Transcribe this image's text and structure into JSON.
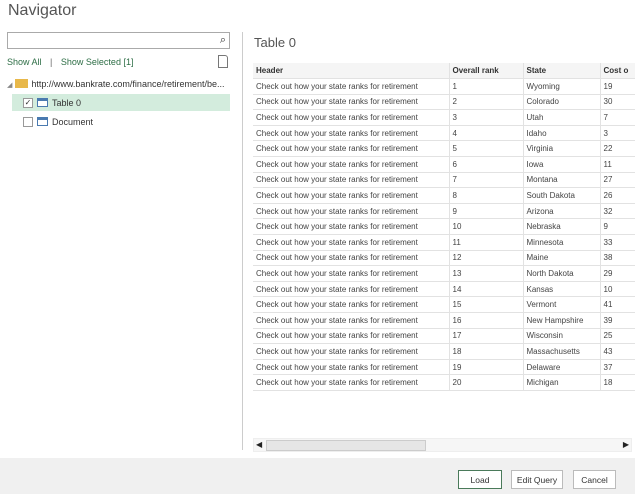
{
  "title": "Navigator",
  "search": {
    "placeholder": "",
    "icon": "search-icon"
  },
  "links": {
    "show_all": "Show All",
    "sep": "|",
    "show_selected": "Show Selected [1]"
  },
  "tree": {
    "root": "http://www.bankrate.com/finance/retirement/be...",
    "items": [
      {
        "label": "Table 0",
        "checked": true
      },
      {
        "label": "Document",
        "checked": false
      }
    ]
  },
  "preview": {
    "title": "Table 0",
    "columns": [
      "Header",
      "Overall rank",
      "State",
      "Cost o"
    ],
    "rows": [
      [
        "Check out how your state ranks for retirement",
        "1",
        "Wyoming",
        "19"
      ],
      [
        "Check out how your state ranks for retirement",
        "2",
        "Colorado",
        "30"
      ],
      [
        "Check out how your state ranks for retirement",
        "3",
        "Utah",
        "7"
      ],
      [
        "Check out how your state ranks for retirement",
        "4",
        "Idaho",
        "3"
      ],
      [
        "Check out how your state ranks for retirement",
        "5",
        "Virginia",
        "22"
      ],
      [
        "Check out how your state ranks for retirement",
        "6",
        "Iowa",
        "11"
      ],
      [
        "Check out how your state ranks for retirement",
        "7",
        "Montana",
        "27"
      ],
      [
        "Check out how your state ranks for retirement",
        "8",
        "South Dakota",
        "26"
      ],
      [
        "Check out how your state ranks for retirement",
        "9",
        "Arizona",
        "32"
      ],
      [
        "Check out how your state ranks for retirement",
        "10",
        "Nebraska",
        "9"
      ],
      [
        "Check out how your state ranks for retirement",
        "11",
        "Minnesota",
        "33"
      ],
      [
        "Check out how your state ranks for retirement",
        "12",
        "Maine",
        "38"
      ],
      [
        "Check out how your state ranks for retirement",
        "13",
        "North Dakota",
        "29"
      ],
      [
        "Check out how your state ranks for retirement",
        "14",
        "Kansas",
        "10"
      ],
      [
        "Check out how your state ranks for retirement",
        "15",
        "Vermont",
        "41"
      ],
      [
        "Check out how your state ranks for retirement",
        "16",
        "New Hampshire",
        "39"
      ],
      [
        "Check out how your state ranks for retirement",
        "17",
        "Wisconsin",
        "25"
      ],
      [
        "Check out how your state ranks for retirement",
        "18",
        "Massachusetts",
        "43"
      ],
      [
        "Check out how your state ranks for retirement",
        "19",
        "Delaware",
        "37"
      ],
      [
        "Check out how your state ranks for retirement",
        "20",
        "Michigan",
        "18"
      ]
    ]
  },
  "buttons": {
    "load": "Load",
    "edit_query": "Edit Query",
    "cancel": "Cancel"
  }
}
